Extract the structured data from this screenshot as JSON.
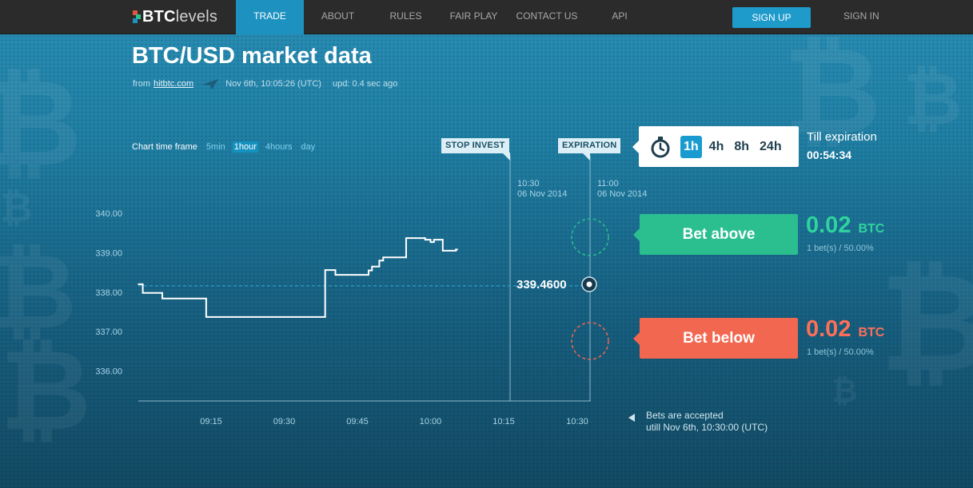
{
  "nav": {
    "logo_bold": "BTC",
    "logo_light": "levels",
    "items": [
      "TRADE",
      "ABOUT",
      "RULES",
      "FAIR PLAY",
      "CONTACT US",
      "API"
    ],
    "active": "TRADE",
    "signup": "SIGN UP",
    "signin": "SIGN IN"
  },
  "header": {
    "title": "BTC/USD market data",
    "from_label": "from",
    "source": "hitbtc.com",
    "timestamp": "Nov 6th, 10:05:26 (UTC)",
    "update": "upd: 0.4 sec ago"
  },
  "timeframe": {
    "label": "Chart time frame",
    "options": [
      "5min",
      "1hour",
      "4hours",
      "day"
    ],
    "active": "1hour"
  },
  "markers": {
    "stop_invest": {
      "label": "STOP INVEST",
      "time": "10:30",
      "date": "06 Nov 2014"
    },
    "expiration": {
      "label": "EXPIRATION",
      "time": "11:00",
      "date": "06 Nov 2014"
    }
  },
  "expiration_panel": {
    "durations": [
      "1h",
      "4h",
      "8h",
      "24h"
    ],
    "active": "1h",
    "till_label": "Till expiration",
    "countdown": "00:54:34"
  },
  "bets": {
    "above": {
      "label": "Bet above",
      "amount": "0.02",
      "currency": "BTC",
      "stats": "1 bet(s) / 50.00%",
      "color": "#2bbf90"
    },
    "below": {
      "label": "Bet below",
      "amount": "0.02",
      "currency": "BTC",
      "stats": "1 bet(s) / 50.00%",
      "color": "#f26750"
    }
  },
  "current_price": "339.4600",
  "accept_note": {
    "line1": "Bets are accepted",
    "line2": "utill Nov 6th, 10:30:00 (UTC)"
  },
  "chart_data": {
    "type": "line",
    "y_ticks": [
      "340.00",
      "339.00",
      "338.00",
      "337.00",
      "336.00"
    ],
    "x_ticks": [
      "09:15",
      "09:30",
      "09:45",
      "10:00",
      "10:15",
      "10:30"
    ],
    "ylim": [
      335.25,
      340.4
    ],
    "xlim_minutes": [
      540,
      583
    ],
    "current_level": 338.16,
    "series": [
      {
        "points": [
          [
            540.0,
            338.2
          ],
          [
            541.0,
            338.2
          ],
          [
            541.0,
            337.98
          ],
          [
            545.0,
            337.98
          ],
          [
            545.0,
            337.84
          ],
          [
            554.0,
            337.84
          ],
          [
            554.0,
            337.37
          ],
          [
            578.4,
            337.37
          ],
          [
            578.4,
            338.56
          ],
          [
            580.5,
            338.56
          ],
          [
            580.5,
            338.44
          ],
          [
            587.3,
            338.44
          ],
          [
            587.3,
            338.55
          ],
          [
            588.0,
            338.55
          ],
          [
            588.0,
            338.65
          ],
          [
            589.5,
            338.65
          ],
          [
            589.5,
            338.8
          ],
          [
            590.3,
            338.8
          ],
          [
            590.3,
            338.88
          ],
          [
            595.0,
            338.88
          ],
          [
            595.0,
            339.37
          ],
          [
            598.9,
            339.37
          ],
          [
            598.9,
            339.33
          ],
          [
            600.0,
            339.33
          ],
          [
            600.0,
            339.27
          ],
          [
            600.7,
            339.27
          ],
          [
            600.7,
            339.33
          ],
          [
            602.5,
            339.33
          ],
          [
            602.5,
            339.05
          ],
          [
            605.2,
            339.05
          ],
          [
            605.2,
            339.08
          ],
          [
            605.6,
            339.08
          ]
        ]
      }
    ]
  }
}
